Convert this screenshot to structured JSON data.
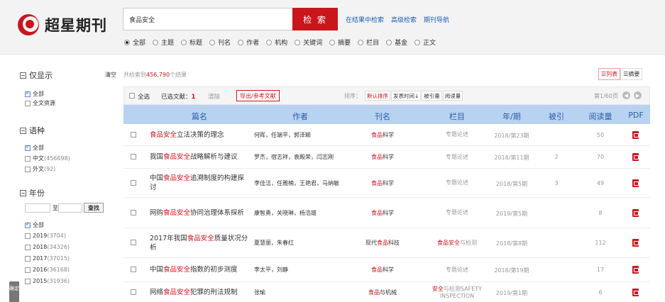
{
  "header": {
    "logo_text": "超星期刊",
    "search_value": "食品安全",
    "search_button": "检 索",
    "links": [
      "在结果中检索",
      "高级检索",
      "期刊导航"
    ],
    "search_fields": [
      "全部",
      "主题",
      "标题",
      "刊名",
      "作者",
      "机构",
      "关键词",
      "摘要",
      "栏目",
      "基金",
      "正文"
    ],
    "selected_field": "全部"
  },
  "sidebar": {
    "show_only_title": "仅显示",
    "clear": "清空",
    "show_only": [
      {
        "label": "全部",
        "checked": true
      },
      {
        "label": "全文资源",
        "checked": false
      }
    ],
    "language_title": "语种",
    "languages": [
      {
        "label": "全部",
        "count": "",
        "checked": true
      },
      {
        "label": "中文",
        "count": "(456698)",
        "checked": false
      },
      {
        "label": "外文",
        "count": "(92)",
        "checked": false
      }
    ],
    "year_title": "年份",
    "year_to": "至",
    "year_find": "查找",
    "years": [
      {
        "label": "全部",
        "count": "",
        "checked": true
      },
      {
        "label": "2019",
        "count": "(3704)",
        "checked": false
      },
      {
        "label": "2018",
        "count": "(34326)",
        "checked": false
      },
      {
        "label": "2017",
        "count": "(37015)",
        "checked": false
      },
      {
        "label": "2016",
        "count": "(36168)",
        "checked": false
      },
      {
        "label": "2015",
        "count": "(31936)",
        "checked": false
      }
    ],
    "side_tab": "确定"
  },
  "results": {
    "prefix": "共检索到",
    "count": "456,790",
    "suffix": "个结果",
    "view_list": "列表",
    "view_abstract": "摘要"
  },
  "toolbar": {
    "select_all": "全选",
    "selected_label": "已选文献：",
    "selected_count": "1",
    "clear": "清除",
    "export": "导出/参考文献",
    "sort_label": "排序：",
    "sorts": [
      "默认排序",
      "发表时间↓",
      "被引量",
      "阅读量"
    ],
    "page_info": "第1/60页"
  },
  "table": {
    "headers": [
      "篇名",
      "作者",
      "刊名",
      "栏目",
      "年/期",
      "被引",
      "阅读量",
      "PDF"
    ],
    "rows": [
      {
        "title_pre": "",
        "title_hl": "食品安全",
        "title_post": "立法决策的理念",
        "authors": "何晖，任端平，郭泽颖",
        "journal_pre": "",
        "journal_hl": "食品",
        "journal_post": "科学",
        "column_pre": "",
        "column_hl": "",
        "column_post": "专题论述",
        "year": "2018/第23期",
        "cited": "",
        "reads": "50"
      },
      {
        "title_pre": "我国",
        "title_hl": "食品安全",
        "title_post": "战略解析与建议",
        "authors": "罗杰，宿志祥，袁殿荣，闫志刚",
        "journal_pre": "",
        "journal_hl": "食品",
        "journal_post": "科学",
        "column_pre": "",
        "column_hl": "",
        "column_post": "专题论述",
        "year": "2018/第11期",
        "cited": "2",
        "reads": "70"
      },
      {
        "title_pre": "中国",
        "title_hl": "食品安全",
        "title_post": "追溯制度的构建探讨",
        "authors": "李佳洁，任雅楠，王艳君，马纳敏",
        "journal_pre": "",
        "journal_hl": "食品",
        "journal_post": "科学",
        "column_pre": "",
        "column_hl": "",
        "column_post": "专题论述",
        "year": "2018/第5期",
        "cited": "3",
        "reads": "49"
      },
      {
        "title_pre": "网购",
        "title_hl": "食品安全",
        "title_post": "协同治理体系探析",
        "authors": "康智勇，关晓琳，杨浩雄",
        "journal_pre": "",
        "journal_hl": "食品",
        "journal_post": "科学",
        "column_pre": "",
        "column_hl": "",
        "column_post": "专题论述",
        "year": "2019/第5期",
        "cited": "",
        "reads": "8"
      },
      {
        "title_pre": "2017年我国",
        "title_hl": "食品安全",
        "title_post": "质量状况分析",
        "authors": "夏慧丽，朱春红",
        "journal_pre": "现代",
        "journal_hl": "食品",
        "journal_post": "科技",
        "column_pre": "",
        "column_hl": "食品安全",
        "column_post": "与检测",
        "year": "2018/第8期",
        "cited": "",
        "reads": "112"
      },
      {
        "title_pre": "中国",
        "title_hl": "食品安全",
        "title_post": "指数的初步测度",
        "authors": "李太平，刘静",
        "journal_pre": "",
        "journal_hl": "食品",
        "journal_post": "科学",
        "column_pre": "",
        "column_hl": "",
        "column_post": "专题论述",
        "year": "2018/第19期",
        "cited": "",
        "reads": "17"
      },
      {
        "title_pre": "网络",
        "title_hl": "食品安全",
        "title_post": "犯罪的刑法规制",
        "authors": "张瑜",
        "journal_pre": "",
        "journal_hl": "食品",
        "journal_post": "与机械",
        "column_pre": "",
        "column_hl": "安全",
        "column_post": "与检测SAFETY INSPECTION",
        "year": "2019/第1期",
        "cited": "",
        "reads": "6"
      }
    ]
  }
}
